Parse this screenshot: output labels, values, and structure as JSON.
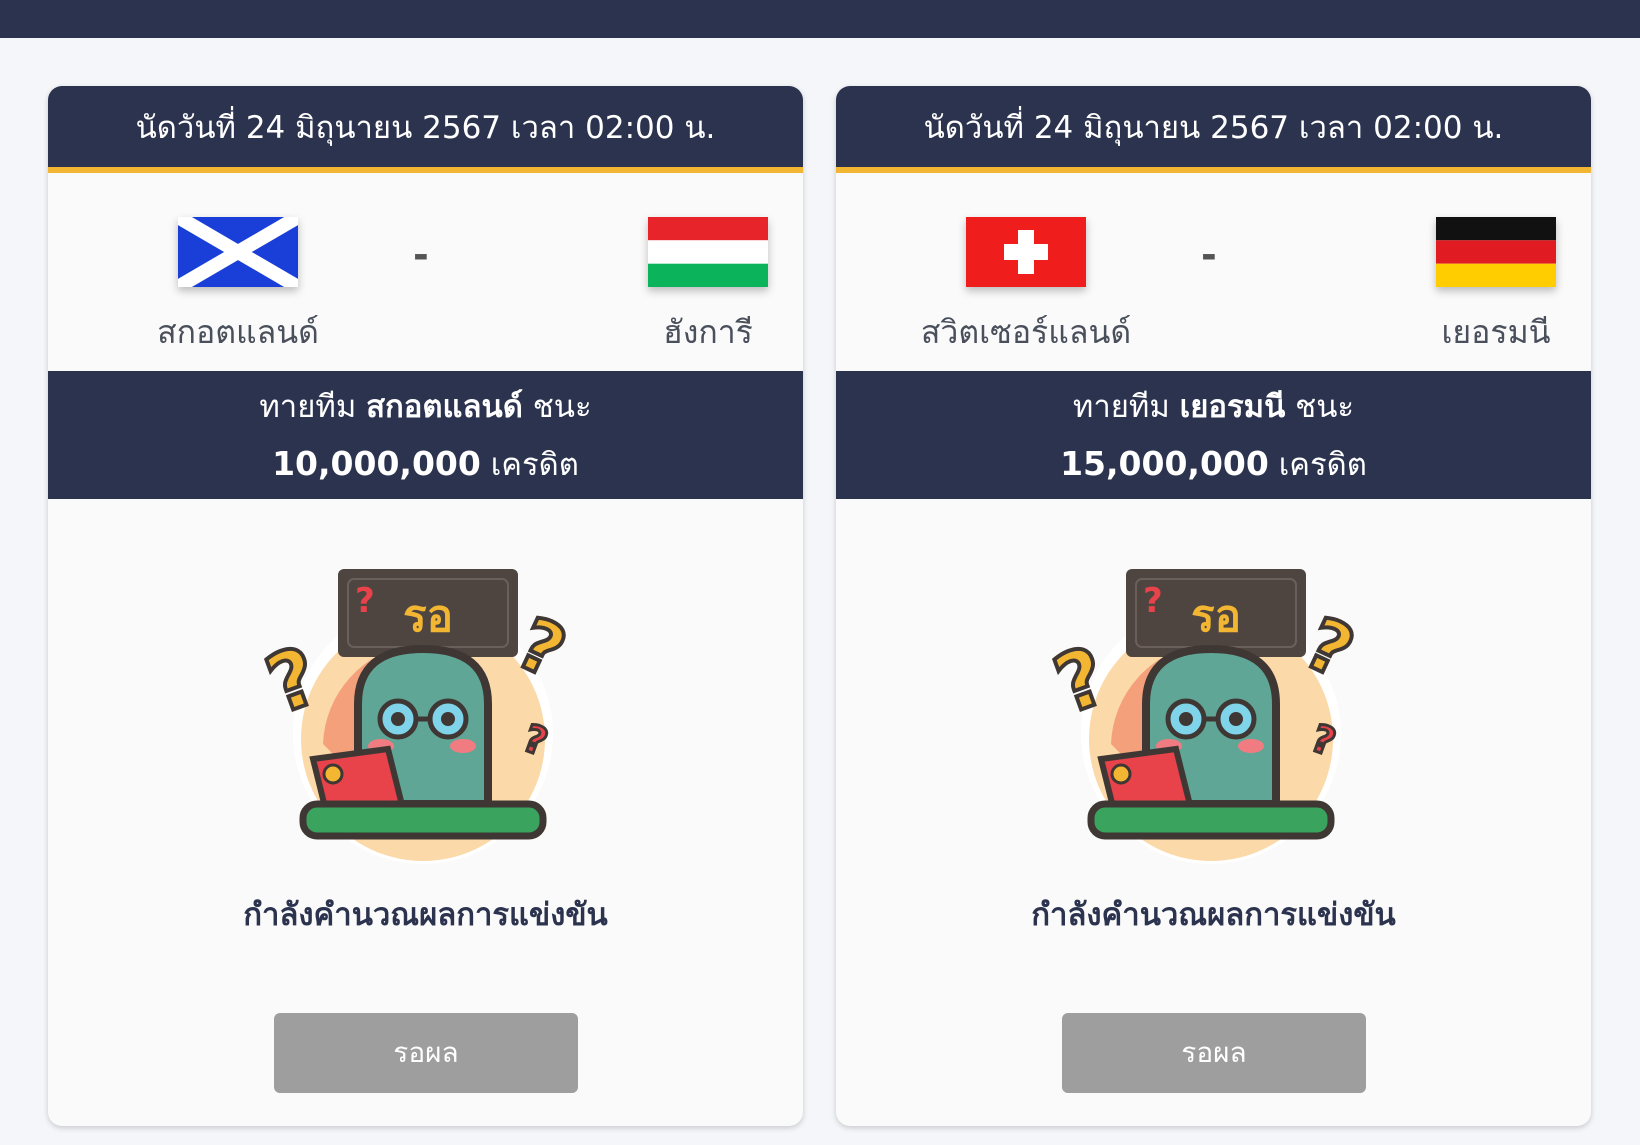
{
  "matches": [
    {
      "date_text": "นัดวันที่ 24 มิถุนายน 2567 เวลา 02:00 น.",
      "home": {
        "name": "สกอตแลนด์",
        "flag": "scotland-flag-icon"
      },
      "away": {
        "name": "ฮังการี",
        "flag": "hungary-flag-icon"
      },
      "separator": "-",
      "prediction_prefix": "ทายทีม",
      "prediction_team": "สกอตแลนด์",
      "prediction_suffix": "ชนะ",
      "credit_amount": "10,000,000",
      "credit_unit": "เครดิต",
      "mascot_sign": "รอ",
      "status_text": "กำลังคำนวณผลการแข่งขัน",
      "button_label": "รอผล"
    },
    {
      "date_text": "นัดวันที่ 24 มิถุนายน 2567 เวลา 02:00 น.",
      "home": {
        "name": "สวิตเซอร์แลนด์",
        "flag": "switzerland-flag-icon"
      },
      "away": {
        "name": "เยอรมนี",
        "flag": "germany-flag-icon"
      },
      "separator": "-",
      "prediction_prefix": "ทายทีม",
      "prediction_team": "เยอรมนี",
      "prediction_suffix": "ชนะ",
      "credit_amount": "15,000,000",
      "credit_unit": "เครดิต",
      "mascot_sign": "รอ",
      "status_text": "กำลังคำนวณผลการแข่งขัน",
      "button_label": "รอผล"
    }
  ],
  "colors": {
    "header_bg": "#2c334e",
    "accent": "#f2b632",
    "button_disabled": "#9e9e9e"
  }
}
